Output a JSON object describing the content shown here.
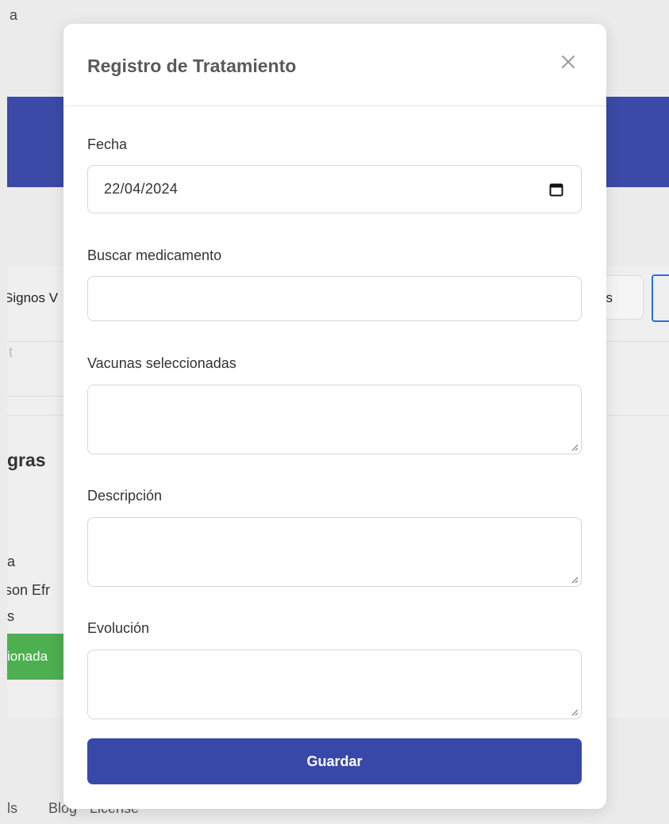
{
  "background": {
    "top_letter": "a",
    "tab_left_label": "Signos V",
    "tab_right_label": "as",
    "faint_text": "t",
    "heading": "gras",
    "lines": [
      "a",
      "son Efr",
      "s"
    ],
    "green_badge": "ionada",
    "footer_links": [
      "ls",
      "Blog",
      "License"
    ]
  },
  "modal": {
    "title": "Registro de Tratamiento",
    "close_icon": "close-icon",
    "fields": {
      "fecha": {
        "label": "Fecha",
        "value": "22/04/2024",
        "icon": "calendar-icon"
      },
      "buscar": {
        "label": "Buscar medicamento",
        "value": "",
        "placeholder": ""
      },
      "vacunas": {
        "label": "Vacunas seleccionadas",
        "value": ""
      },
      "descripcion": {
        "label": "Descripción",
        "value": ""
      },
      "evolucion": {
        "label": "Evolución",
        "value": ""
      }
    },
    "save_label": "Guardar"
  },
  "colors": {
    "primary": "#3848a8",
    "band": "#3a4aa6",
    "success": "#4caf50",
    "focus_outline": "#2c6fd6"
  }
}
